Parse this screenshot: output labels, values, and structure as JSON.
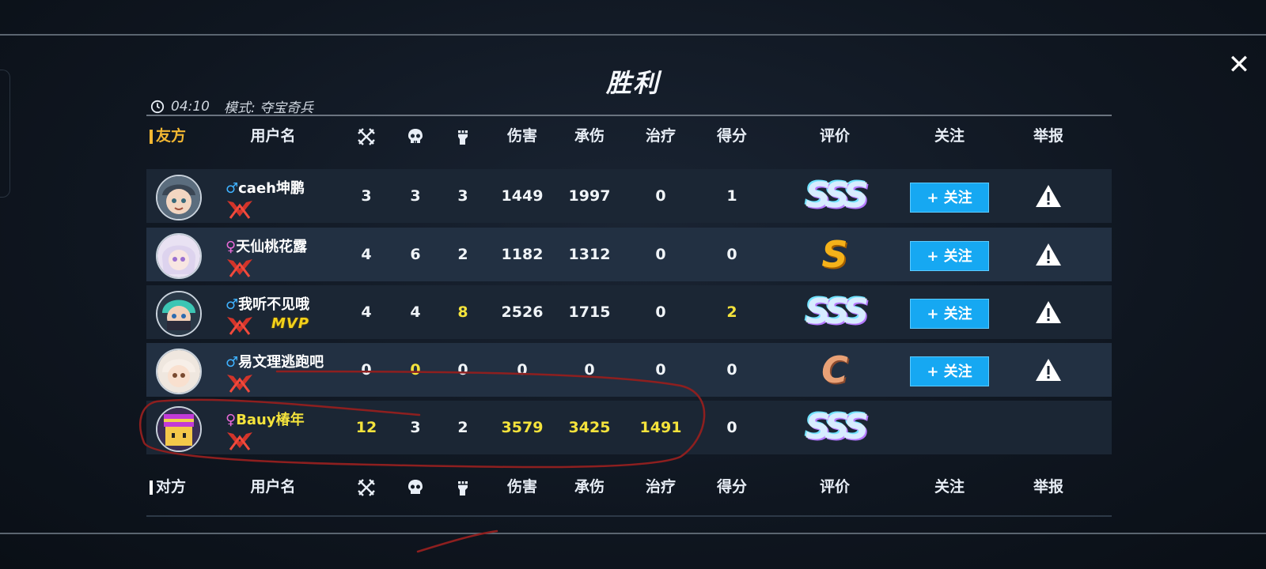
{
  "title": "胜利",
  "meta": {
    "time": "04:10",
    "mode": "模式: 夺宝奇兵"
  },
  "close_label": "✕",
  "headers": {
    "friend_team": "友方",
    "enemy_team": "对方",
    "username": "用户名",
    "damage": "伤害",
    "damage_taken": "承伤",
    "healing": "治疗",
    "score": "得分",
    "rating": "评价",
    "follow": "关注",
    "report": "举报",
    "kills_icon": "crossed-swords-icon",
    "deaths_icon": "skull-icon",
    "assists_icon": "fist-icon"
  },
  "follow_button_label": "+ 关注",
  "players": [
    {
      "gender_symbol": "♂",
      "gender": "male",
      "name": "caeh坤鹏",
      "kills": "3",
      "deaths": "3",
      "assists": "3",
      "damage": "1449",
      "damage_taken": "1997",
      "healing": "0",
      "score": "1",
      "grade": "SSS",
      "mvp": ""
    },
    {
      "gender_symbol": "♀",
      "gender": "female",
      "name": "天仙桃花露",
      "kills": "4",
      "deaths": "6",
      "assists": "2",
      "damage": "1182",
      "damage_taken": "1312",
      "healing": "0",
      "score": "0",
      "grade": "S",
      "mvp": ""
    },
    {
      "gender_symbol": "♂",
      "gender": "male",
      "name": "我听不见哦",
      "kills": "4",
      "deaths": "4",
      "assists": "8",
      "damage": "2526",
      "damage_taken": "1715",
      "healing": "0",
      "score": "2",
      "grade": "SSS",
      "mvp": "MVP"
    },
    {
      "gender_symbol": "♂",
      "gender": "male",
      "name": "易文理逃跑吧",
      "kills": "0",
      "deaths": "0",
      "assists": "0",
      "damage": "0",
      "damage_taken": "0",
      "healing": "0",
      "score": "0",
      "grade": "C",
      "mvp": ""
    },
    {
      "gender_symbol": "♀",
      "gender": "female",
      "name": "Bauy椿年",
      "kills": "12",
      "deaths": "3",
      "assists": "2",
      "damage": "3579",
      "damage_taken": "3425",
      "healing": "1491",
      "score": "0",
      "grade": "SSS",
      "mvp": ""
    }
  ],
  "colors": {
    "highlight": "#f4e33c",
    "follow_button": "#16a8f2",
    "friend_team": "#f2b732"
  }
}
